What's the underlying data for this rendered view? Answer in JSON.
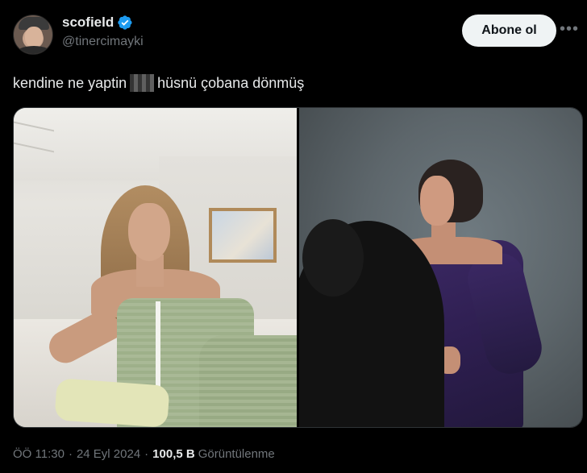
{
  "user": {
    "display_name": "scofield",
    "handle": "@tinercimayki",
    "verified": true,
    "verified_color": "#1d9bf0"
  },
  "follow_button": {
    "label": "Abone ol"
  },
  "more_icon": "more-horizontal-icon",
  "tweet": {
    "text_before": "kendine ne yaptin",
    "text_after": "hüsnü çobana dönmüş"
  },
  "media": {
    "photos": [
      "left-photo",
      "right-photo"
    ]
  },
  "meta": {
    "time": "ÖÖ 11:30",
    "separator": "·",
    "date": "24 Eyl 2024",
    "views_count": "100,5 B",
    "views_label": "Görüntülenme"
  },
  "colors": {
    "background": "#000000",
    "text": "#e7e9ea",
    "muted": "#71767b",
    "button_bg": "#eff3f4",
    "button_text": "#0f1419"
  }
}
